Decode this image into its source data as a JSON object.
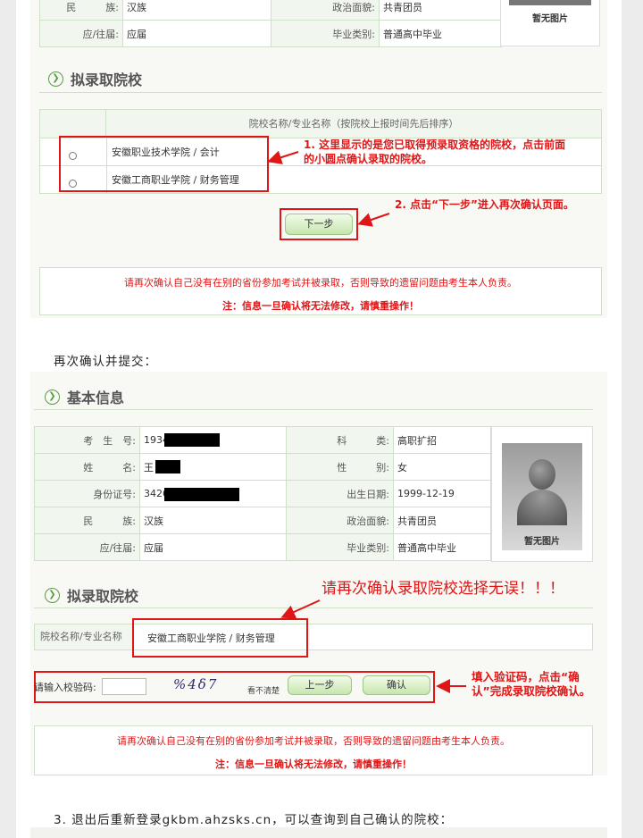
{
  "section1": {
    "info_rows": [
      {
        "label": "民　　　族:",
        "value": "汉族",
        "label2": "政治面貌:",
        "value2": "共青团员"
      },
      {
        "label": "应/往届:",
        "value": "应届",
        "label2": "毕业类别:",
        "value2": "普通高中毕业"
      }
    ],
    "photo_caption": "暂无图片",
    "title": "拟录取院校",
    "table_header": "院校名称/专业名称（按院校上报时间先后排序）",
    "options": [
      "安徽职业技术学院 / 会计",
      "安徽工商职业学院 / 财务管理"
    ],
    "annotation1": [
      "1. 这里显示的是您已取得预录取资格的院校，点击前面",
      "的小圆点确认录取的院校。"
    ],
    "annotation2": "2. 点击“下一步”进入再次确认页面。",
    "next_button": "下一步",
    "notice_line1": "请再次确认自己没有在别的省份参加考试并被录取，否则导致的遗留问题由考生本人负责。",
    "notice_line2": "注：信息一旦确认将无法修改，请慎重操作！"
  },
  "caption_mid": "再次确认并提交：",
  "section2": {
    "title_basic": "基本信息",
    "rows": [
      {
        "label": "考　生　号:",
        "value": "1934",
        "label2": "科　　　类:",
        "value2": "高职扩招"
      },
      {
        "label": "姓　　　名:",
        "value": "王",
        "label2": "性　　　别:",
        "value2": "女"
      },
      {
        "label": "身份证号:",
        "value": "3426",
        "label2": "出生日期:",
        "value2": "1999-12-19"
      },
      {
        "label": "民　　　族:",
        "value": "汉族",
        "label2": "政治面貌:",
        "value2": "共青团员"
      },
      {
        "label": "应/往届:",
        "value": "应届",
        "label2": "毕业类别:",
        "value2": "普通高中毕业"
      }
    ],
    "photo_caption": "暂无图片",
    "title_school": "拟录取院校",
    "reconfirm_note": "请再次确认录取院校选择无误！！！",
    "school_label": "院校名称/专业名称",
    "school_value": "安徽工商职业学院 / 财务管理",
    "captcha_label": "请输入校验码:",
    "captcha_input_value": "",
    "captcha_text": "%4δ7",
    "captcha_refresh": "看不清楚",
    "prev_button": "上一步",
    "confirm_button": "确认",
    "captcha_note": [
      "填入验证码，点击“确",
      "认”完成录取院校确认。"
    ],
    "notice_line1": "请再次确认自己没有在别的省份参加考试并被录取，否则导致的遗留问题由考生本人负责。",
    "notice_line2": "注：信息一旦确认将无法修改，请慎重操作！"
  },
  "caption_bottom": "3. 退出后重新登录gkbm.ahzsks.cn，可以查询到自己确认的院校：",
  "colors": {
    "accent_red": "#e01515",
    "green": "#5a9a44",
    "border": "#cfe0c8"
  }
}
